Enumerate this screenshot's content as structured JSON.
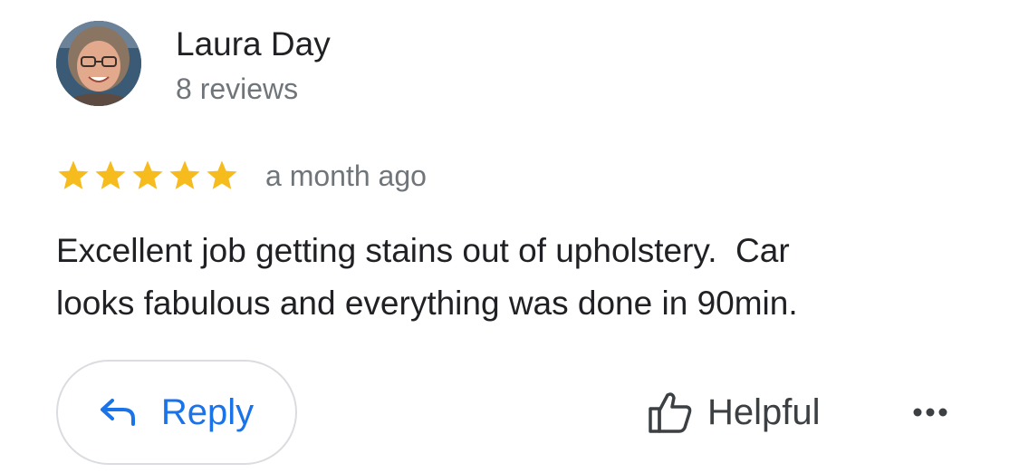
{
  "review": {
    "author": {
      "name": "Laura Day",
      "reviews_count": "8 reviews",
      "avatar": "profile-photo"
    },
    "rating": 5,
    "rating_max": 5,
    "time_ago": "a month ago",
    "text": "Excellent job getting stains out of upholstery.  Car\nlooks fabulous and everything was done in 90min.",
    "actions": {
      "reply_label": "Reply",
      "helpful_label": "Helpful",
      "reply_icon": "reply-arrow-icon",
      "helpful_icon": "thumbs-up-icon",
      "more_icon": "more-horizontal-icon"
    }
  },
  "colors": {
    "star": "#F6BB1D",
    "accent": "#1A73E8",
    "secondary_text": "#70757A",
    "border": "#DADCE0"
  }
}
